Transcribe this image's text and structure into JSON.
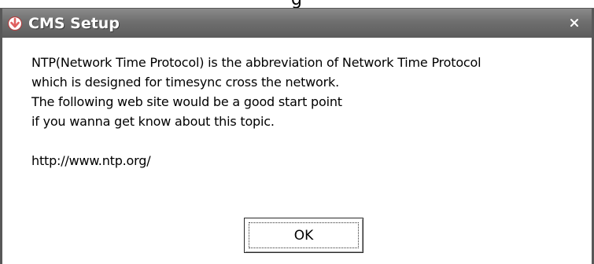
{
  "background_partial_text": "g",
  "dialog": {
    "title": "CMS Setup",
    "title_icon": "download-arrow-icon",
    "close_icon": "close-icon",
    "close_glyph": "×",
    "message_lines": [
      "NTP(Network Time Protocol) is the abbreviation of Network Time Protocol",
      "which is designed for timesync cross the network.",
      "The following web site would be a good start point",
      "if you wanna get know about this topic."
    ],
    "url": "http://www.ntp.org/",
    "ok_label": "OK"
  },
  "colors": {
    "titlebar": "#6f6f6f",
    "border": "#585858",
    "title_text": "#ffffff",
    "icon_accent": "#e06060"
  }
}
